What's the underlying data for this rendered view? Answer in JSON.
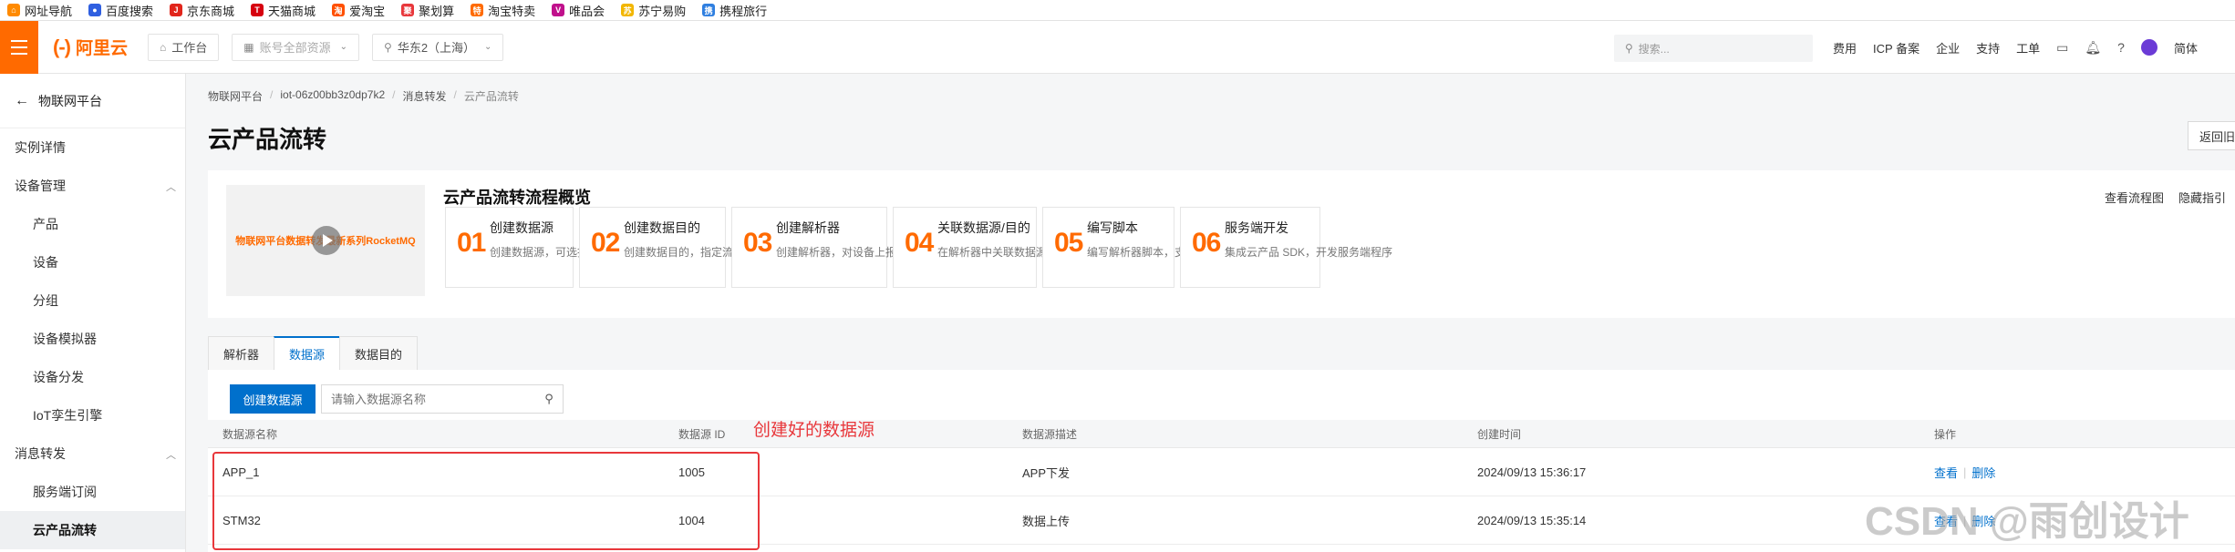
{
  "bookmarks": [
    {
      "label": "网址导航",
      "icon": "home-icon",
      "color": "#ff8a00"
    },
    {
      "label": "百度搜索",
      "icon": "baidu-icon",
      "color": "#2f5fe0"
    },
    {
      "label": "京东商城",
      "icon": "jd-icon",
      "color": "#e1251b"
    },
    {
      "label": "天猫商城",
      "icon": "tmall-icon",
      "color": "#d6000f"
    },
    {
      "label": "爱淘宝",
      "icon": "taobao-icon",
      "color": "#ff5000"
    },
    {
      "label": "聚划算",
      "icon": "juhuasuan-icon",
      "color": "#e8373b"
    },
    {
      "label": "淘宝特卖",
      "icon": "taobao-sale-icon",
      "color": "#ff6a00"
    },
    {
      "label": "唯品会",
      "icon": "vip-icon",
      "color": "#c0118c"
    },
    {
      "label": "苏宁易购",
      "icon": "suning-icon",
      "color": "#f2b600"
    },
    {
      "label": "携程旅行",
      "icon": "ctrip-icon",
      "color": "#2f7fe0"
    }
  ],
  "topnav": {
    "logo_mark": "(-)",
    "logo_text": "阿里云",
    "workbench": "工作台",
    "account_resources": "账号全部资源",
    "region": "华东2（上海）",
    "search_placeholder": "搜索...",
    "links": [
      "费用",
      "ICP 备案",
      "企业",
      "支持",
      "工单"
    ],
    "language": "简体"
  },
  "sidebar": {
    "back_label": "物联网平台",
    "items": [
      {
        "label": "实例详情",
        "level": "top",
        "expandable": false,
        "active": false
      },
      {
        "label": "设备管理",
        "level": "top",
        "expandable": true,
        "active": false
      },
      {
        "label": "产品",
        "level": "sub",
        "expandable": false,
        "active": false
      },
      {
        "label": "设备",
        "level": "sub",
        "expandable": false,
        "active": false
      },
      {
        "label": "分组",
        "level": "sub",
        "expandable": false,
        "active": false
      },
      {
        "label": "设备模拟器",
        "level": "sub",
        "expandable": false,
        "active": false
      },
      {
        "label": "设备分发",
        "level": "sub",
        "expandable": false,
        "active": false
      },
      {
        "label": "IoT孪生引擎",
        "level": "sub",
        "expandable": false,
        "active": false
      },
      {
        "label": "消息转发",
        "level": "top",
        "expandable": true,
        "active": false
      },
      {
        "label": "服务端订阅",
        "level": "sub",
        "expandable": false,
        "active": false
      },
      {
        "label": "云产品流转",
        "level": "sub",
        "expandable": false,
        "active": true
      }
    ]
  },
  "breadcrumb": [
    "物联网平台",
    "iot-06z00bb3z0dp7k2",
    "消息转发",
    "云产品流转"
  ],
  "page_title": "云产品流转",
  "back_button": "返回旧",
  "overview": {
    "video_caption": "物联网平台数据转发最新系列RocketMQ",
    "title": "云产品流转流程概览",
    "links": [
      "查看流程图",
      "隐藏指引"
    ],
    "steps": [
      {
        "num": "01",
        "title": "创建数据源",
        "desc": "创建数据源，可选择多个Topic"
      },
      {
        "num": "02",
        "title": "创建数据目的",
        "desc": "创建数据目的，指定流转到的云产品"
      },
      {
        "num": "03",
        "title": "创建解析器",
        "desc": "创建解析器，对设备上报的数据进行解析"
      },
      {
        "num": "04",
        "title": "关联数据源/目的",
        "desc": "在解析器中关联数据源和数据目的"
      },
      {
        "num": "05",
        "title": "编写脚本",
        "desc": "编写解析器脚本，支持内置函数"
      },
      {
        "num": "06",
        "title": "服务端开发",
        "desc": "集成云产品 SDK，开发服务端程序"
      }
    ]
  },
  "tabs": [
    {
      "label": "解析器",
      "active": false
    },
    {
      "label": "数据源",
      "active": true
    },
    {
      "label": "数据目的",
      "active": false
    }
  ],
  "toolbar": {
    "create_label": "创建数据源",
    "search_placeholder": "请输入数据源名称"
  },
  "table": {
    "headers": [
      "数据源名称",
      "数据源 ID",
      "数据源描述",
      "创建时间",
      "操作"
    ],
    "rows": [
      {
        "name": "APP_1",
        "id": "1005",
        "desc": "APP下发",
        "created": "2024/09/13 15:36:17",
        "view": "查看",
        "delete": "删除"
      },
      {
        "name": "STM32",
        "id": "1004",
        "desc": "数据上传",
        "created": "2024/09/13 15:35:14",
        "view": "查看",
        "delete": "删除"
      }
    ]
  },
  "annotation": {
    "label": "创建好的数据源",
    "color": "#e8373b"
  },
  "watermark": "CSDN @雨创设计",
  "colors": {
    "brand": "#ff6a00",
    "primary": "#0070cc"
  }
}
